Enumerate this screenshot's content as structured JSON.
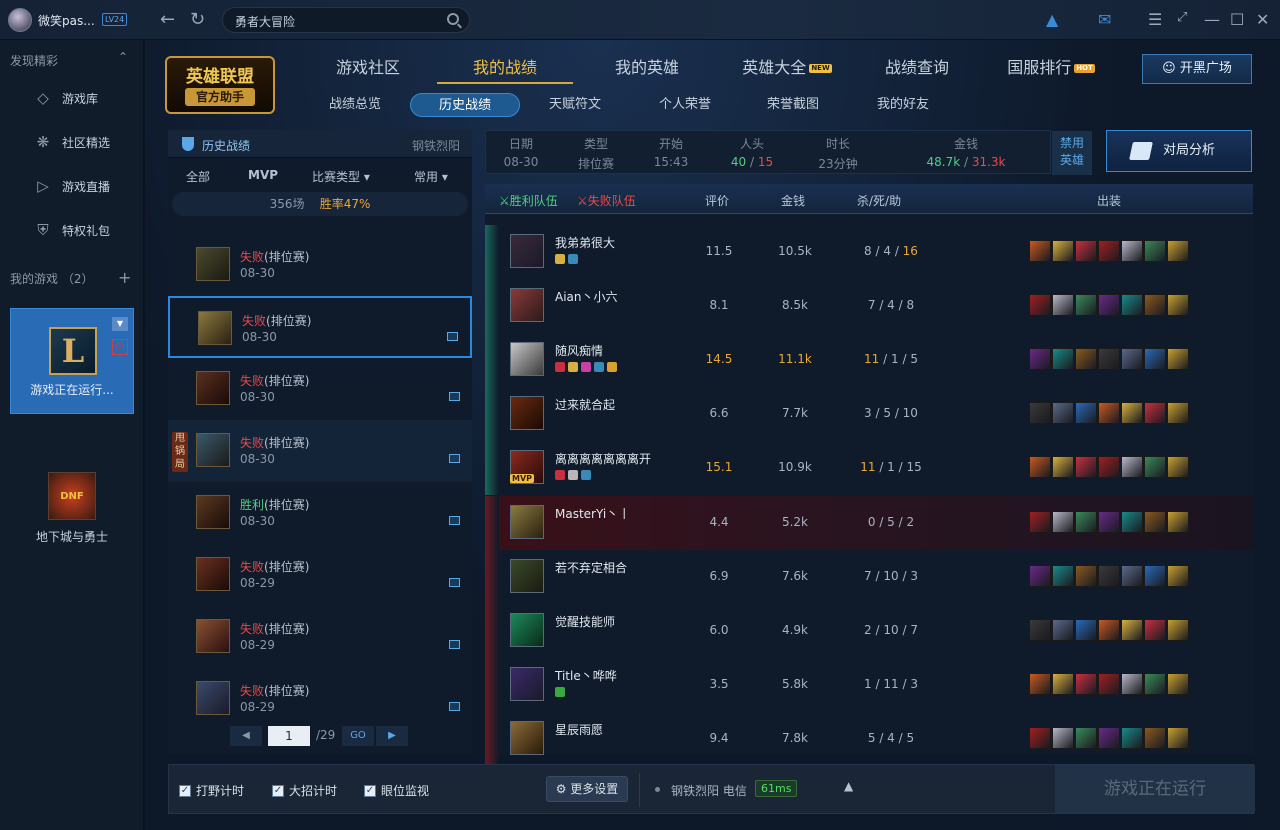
{
  "topbar": {
    "username": "微笑pas...",
    "level": "LV24",
    "search_value": "勇者大冒险"
  },
  "sidebar": {
    "discover_title": "发现精彩",
    "items": [
      {
        "label": "游戏库",
        "icon": "diamond-icon"
      },
      {
        "label": "社区精选",
        "icon": "star-burst-icon"
      },
      {
        "label": "游戏直播",
        "icon": "play-icon"
      },
      {
        "label": "特权礼包",
        "icon": "gift-shield-icon"
      }
    ],
    "my_games_title": "我的游戏 （2）",
    "game1_status": "游戏正在运行...",
    "game2_name": "地下城与勇士",
    "game2_logo_text": "DNF"
  },
  "header": {
    "logo_line1": "英雄联盟",
    "logo_line2": "官方助手",
    "main_tabs": [
      "游戏社区",
      "我的战绩",
      "我的英雄",
      "英雄大全",
      "战绩查询",
      "国服排行"
    ],
    "new_badge": "NEW",
    "hot_badge": "HOT",
    "kaihei_label": "开黑广场",
    "sub_tabs": [
      "战绩总览",
      "历史战绩",
      "天赋符文",
      "个人荣誉",
      "荣誉截图",
      "我的好友"
    ]
  },
  "history": {
    "title": "历史战绩",
    "server": "钢铁烈阳",
    "filters": [
      "全部",
      "MVP",
      "比赛类型",
      "常用"
    ],
    "total_games": "356场",
    "winrate_label": "胜率",
    "winrate_value": "47%",
    "shuaiguo_label": "甩锅局",
    "rows": [
      {
        "result": "失败",
        "type": "(排位赛)",
        "date": "08-30",
        "win": false
      },
      {
        "result": "失败",
        "type": "(排位赛)",
        "date": "08-30",
        "win": false
      },
      {
        "result": "失败",
        "type": "(排位赛)",
        "date": "08-30",
        "win": false
      },
      {
        "result": "失败",
        "type": "(排位赛)",
        "date": "08-30",
        "win": false
      },
      {
        "result": "胜利",
        "type": "(排位赛)",
        "date": "08-30",
        "win": true
      },
      {
        "result": "失败",
        "type": "(排位赛)",
        "date": "08-29",
        "win": false
      },
      {
        "result": "失败",
        "type": "(排位赛)",
        "date": "08-29",
        "win": false
      },
      {
        "result": "失败",
        "type": "(排位赛)",
        "date": "08-29",
        "win": false
      }
    ],
    "page_current": "1",
    "page_total": "/29",
    "go_label": "GO"
  },
  "summary": {
    "date_k": "日期",
    "date_v": "08-30",
    "type_k": "类型",
    "type_v": "排位赛",
    "start_k": "开始",
    "start_v": "15:43",
    "kills_k": "人头",
    "kills_a": "40",
    "kills_sep": " / ",
    "kills_b": "15",
    "dur_k": "时长",
    "dur_v": "23分钟",
    "gold_k": "金钱",
    "gold_a": "48.7k",
    "gold_sep": " / ",
    "gold_b": "31.3k",
    "ban_label": "禁用英雄",
    "analyze_label": "对局分析"
  },
  "team": {
    "win_team": "胜利队伍",
    "lose_team": "失败队伍",
    "col_score": "评价",
    "col_gold": "金钱",
    "col_kda": "杀/死/助",
    "col_items": "出装",
    "mvp_label": "MVP",
    "players": [
      {
        "name": "我弟弟很大",
        "score": "11.5",
        "gold": "10.5k",
        "k": "8",
        "d": "4",
        "a": "16",
        "team": "win"
      },
      {
        "name": "Aian丶小六",
        "score": "8.1",
        "gold": "8.5k",
        "k": "7",
        "d": "4",
        "a": "8",
        "team": "win"
      },
      {
        "name": "随风痴情",
        "score": "14.5",
        "gold": "11.1k",
        "k": "11",
        "d": "1",
        "a": "5",
        "team": "win"
      },
      {
        "name": "过来就合起",
        "score": "6.6",
        "gold": "7.7k",
        "k": "3",
        "d": "5",
        "a": "10",
        "team": "win"
      },
      {
        "name": "离离离离离离离开",
        "score": "15.1",
        "gold": "10.9k",
        "k": "11",
        "d": "1",
        "a": "15",
        "team": "win"
      },
      {
        "name": "MasterYi丶丨",
        "score": "4.4",
        "gold": "5.2k",
        "k": "0",
        "d": "5",
        "a": "2",
        "team": "lose"
      },
      {
        "name": "若不弃定相合",
        "score": "6.9",
        "gold": "7.6k",
        "k": "7",
        "d": "10",
        "a": "3",
        "team": "lose"
      },
      {
        "name": "觉醒技能师",
        "score": "6.0",
        "gold": "4.9k",
        "k": "2",
        "d": "10",
        "a": "7",
        "team": "lose"
      },
      {
        "name": "Title丶哗哗",
        "score": "3.5",
        "gold": "5.8k",
        "k": "1",
        "d": "11",
        "a": "3",
        "team": "lose"
      },
      {
        "name": "星辰雨愿",
        "score": "9.4",
        "gold": "7.8k",
        "k": "5",
        "d": "4",
        "a": "5",
        "team": "lose"
      }
    ]
  },
  "footer": {
    "chk1": "打野计时",
    "chk2": "大招计时",
    "chk3": "眼位监视",
    "more_label": "更多设置",
    "net_server": "钢铁烈阳",
    "net_isp": "电信",
    "ping": "61ms",
    "run_label": "游戏正在运行"
  },
  "colors": {
    "accent": "#2a88e0",
    "win": "#50d080",
    "lose": "#e84a4a",
    "gold": "#e8a838"
  }
}
